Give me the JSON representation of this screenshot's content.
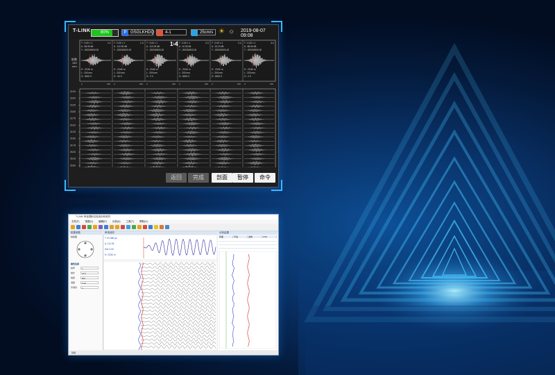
{
  "device": {
    "logo": "T-LINK",
    "battery": {
      "percent_text": "80%",
      "level": 0.8
    },
    "project": {
      "tag": "P",
      "name": "GSGLKHDQ"
    },
    "file": {
      "tag": "F",
      "name": "4-1"
    },
    "speed": {
      "text": "25cm/s"
    },
    "datetime": "2019-08-07 09:08",
    "section_label": "1-4",
    "side_labels": [
      "桩数",
      "150",
      "mm"
    ],
    "top_panels": [
      {
        "t": "T : 0.00  × 1",
        "n": "1-2",
        "a": "A : 65.05 dB",
        "y": "Y : 200000000.00",
        "h": "H : 23.50 m",
        "l": "L : 200 mm",
        "g": "G : 8000 X",
        "x0": "0",
        "x1": "200"
      },
      {
        "t": "T : 0.00  × 1",
        "n": "1-3",
        "a": "A : 112.05 dB",
        "y": "Y : 200000000.00",
        "h": "H : 23.50 m",
        "l": "L : 200 mm",
        "g": "G : 40 X",
        "x0": "0",
        "x1": "200"
      },
      {
        "t": "T : 0.00  × 1",
        "n": "1-4",
        "a": "A : 112.05 dB",
        "y": "Y : 200000000.00",
        "h": "H : 23.50 m",
        "l": "L : 200 mm",
        "g": "G : 2 X",
        "x0": "0",
        "x1": "200"
      },
      {
        "t": "T : 0.00  × 1",
        "n": "2-3",
        "a": "A : 10.05 dB",
        "y": "Y : 200000000.00",
        "h": "H : 23.50 m",
        "l": "L : 200 mm",
        "g": "G : 8000 X",
        "x0": "0",
        "x1": "200"
      },
      {
        "t": "T : 0.00  × 1",
        "n": "2-4",
        "a": "A : 10.10 dB",
        "y": "Y : 200000000.00",
        "h": "H : 23.50 m",
        "l": "L : 200 mm",
        "g": "G : 8000 X",
        "x0": "0",
        "x1": "200"
      },
      {
        "t": "T : 0.00  × 1",
        "n": "3-4",
        "a": "A : 86.54 dB",
        "y": "Y : 200000000.00",
        "h": "H : 23.50 m",
        "l": "L : 200 mm",
        "g": "G : 2 X",
        "x0": "0",
        "x1": "200"
      }
    ],
    "depth_ticks": [
      "22.00",
      "23.00",
      "23.25",
      "23.50",
      "23.75",
      "24.00",
      "24.25",
      "24.50",
      "24.75",
      "25.00",
      "25.25",
      "25.50",
      "26.00"
    ],
    "buttons": [
      {
        "label": "返回",
        "enabled": false
      },
      {
        "label": "完成",
        "enabled": false
      },
      {
        "label": "剖面",
        "enabled": true
      },
      {
        "label": "暂停",
        "enabled": true
      },
      {
        "label": "命令",
        "enabled": true
      }
    ],
    "colors": {
      "battery": "#1fc21f",
      "project_tag": "#2f6fe0",
      "file_tag": "#e0553a",
      "speed_tag": "#2fa3e0",
      "sun": "#f0c020"
    }
  },
  "software": {
    "title": "T-LINK 声波透射法检测分析软件",
    "menu": [
      "文件(F)",
      "视图(V)",
      "编辑(E)",
      "分析(A)",
      "工具(T)",
      "帮助(H)"
    ],
    "left_panel_title": "桩基参数",
    "left_section": "桩截面",
    "props_title": "属性信息",
    "props": [
      {
        "label": "桩号",
        "value": "1"
      },
      {
        "label": "桩长",
        "value": "23.5"
      },
      {
        "label": "桩径",
        "value": "800"
      },
      {
        "label": "测距",
        "value": "0.25"
      },
      {
        "label": "声测管",
        "value": "4"
      }
    ],
    "center_title": "声测波形",
    "center_readouts": [
      "T: 31.986 μs",
      "A: 112.05",
      "Sdt: 0.00",
      "H: 23.50 m"
    ],
    "right_title": "分析结果",
    "table_head": [
      "剖面",
      "声速",
      "波幅",
      "PSD"
    ],
    "status": "就绪"
  }
}
